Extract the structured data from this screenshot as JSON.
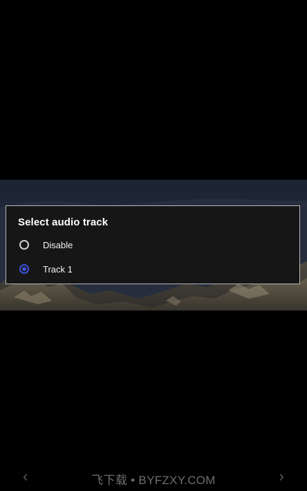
{
  "dialog": {
    "title": "Select audio track",
    "options": [
      {
        "label": "Disable",
        "selected": false
      },
      {
        "label": "Track 1",
        "selected": true
      }
    ]
  },
  "footer": {
    "watermark": "飞下载 • BYFZXY.COM",
    "left_icon": "chevron-left-icon",
    "right_icon": "chevron-right-icon"
  },
  "colors": {
    "accent": "#3f51d8",
    "dialog_background": "#161616",
    "dialog_border": "#b8b8b8",
    "screen_background": "#000000"
  }
}
